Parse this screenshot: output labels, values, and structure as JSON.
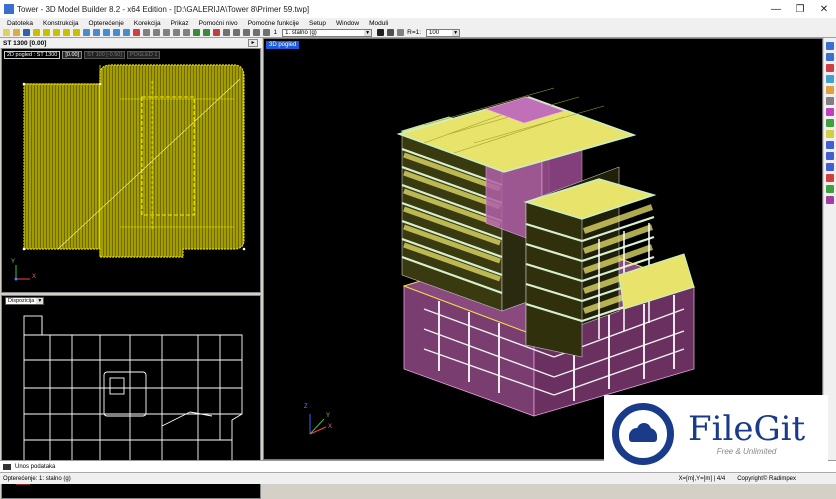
{
  "window": {
    "title": "Tower - 3D Model Builder 8.2 - x64 Edition - [D:\\GALERIJA\\Tower 8\\Primer 59.twp]",
    "minimize": "—",
    "maximize": "❐",
    "close": "✕"
  },
  "menu": [
    "Datoteka",
    "Konstrukcija",
    "Opterećenje",
    "Korekcija",
    "Prikaz",
    "Pomoćni nivo",
    "Pomoćne funkcije",
    "Setup",
    "Window",
    "Moduli"
  ],
  "toolbar": {
    "load_case_number": "1",
    "load_case": "1. stalno (g)",
    "r_label": "R=1:",
    "scale": "100"
  },
  "left_panel": {
    "story_label": "ST 1300   [0.00]",
    "nav_arrow": "▸",
    "tabs": [
      "2D pogled : ST 1300",
      "[0.00]",
      "ST 100 [-0.50]",
      "POGLED 1"
    ],
    "axis_x": "X",
    "axis_y": "Y",
    "disposition_label": "Dispozicija"
  },
  "view3d": {
    "tab_label": "3D pogled",
    "axis_x": "X",
    "axis_y": "Y",
    "axis_z": "Z"
  },
  "command_line": {
    "text": "Unos podataka"
  },
  "status": {
    "left": "Opterećenje: 1: stalno (g)",
    "right_units": "X=[m],Y=[m] | 4/4",
    "right_copyright": "Copyright© Radimpex"
  },
  "watermark": {
    "name": "FileGit",
    "tagline": "Free & Unlimited"
  },
  "colors": {
    "slab": "#e8e36a",
    "core": "#d98ad9",
    "beams": "#f5f5f5",
    "plan_yellow": "#c8c000",
    "selection_blue": "#1e5bd6"
  }
}
